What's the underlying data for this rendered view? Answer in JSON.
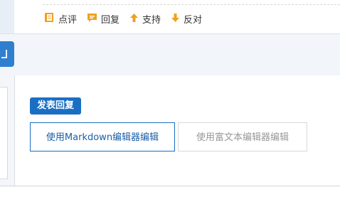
{
  "actions": [
    {
      "label": "点评",
      "icon": "comment-book-icon"
    },
    {
      "label": "回复",
      "icon": "reply-icon"
    },
    {
      "label": "支持",
      "icon": "arrow-up-icon"
    },
    {
      "label": "反对",
      "icon": "arrow-down-icon"
    }
  ],
  "reply": {
    "tag_label": "发表回复",
    "tabs": [
      {
        "label": "使用Markdown编辑器编辑",
        "active": true
      },
      {
        "label": "使用富文本编辑器编辑",
        "active": false
      }
    ]
  },
  "colors": {
    "accent": "#1a6fc4",
    "icon_orange": "#f0a020",
    "band": "#f2f5f9"
  }
}
